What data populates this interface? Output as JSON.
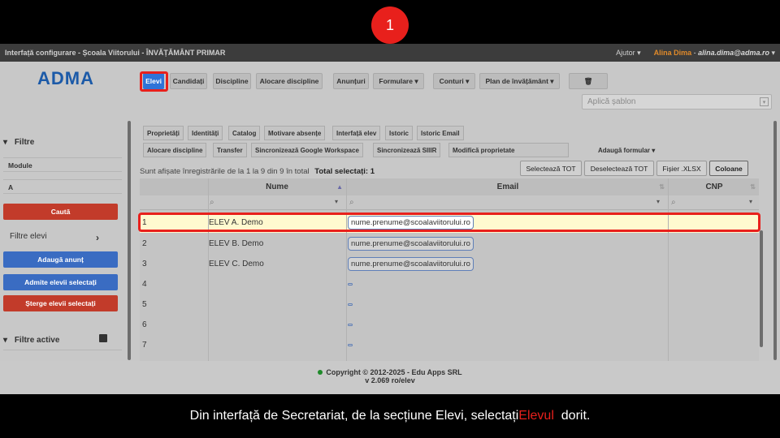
{
  "step": "1",
  "topbar": {
    "title": "Interfață configurare - Școala Viitorului - ÎNVĂȚĂMÂNT PRIMAR",
    "help": "Ajutor ▾",
    "user": "Alina Dima",
    "sep": " - ",
    "email": "alina.dima@adma.ro",
    "caret": "▾"
  },
  "logo": "ADMA",
  "toolbar": {
    "elevi": "Elevi",
    "candidati": "Candidați",
    "discipline": "Discipline",
    "alocare": "Alocare discipline",
    "anunturi": "Anunțuri",
    "formulare": "Formulare ▾",
    "conturi": "Conturi ▾",
    "plan": "Plan de învățământ ▾",
    "trash": "🗑"
  },
  "template_placeholder": "Aplică șablon",
  "sidebar": {
    "filters_title": "Filtre",
    "module_label": "Module",
    "module_value": "A",
    "search_button": "Caută",
    "students_filter": "Filtre elevi",
    "add_announcement": "Adaugă anunț",
    "admit_selected": "Admite elevii selectați",
    "delete_selected": "Șterge elevii selectați",
    "active_filters": "Filtre active"
  },
  "tabs_row1": [
    "Proprietăți",
    "Identități",
    "Catalog",
    "Motivare absențe",
    "Interfață elev",
    "Istoric",
    "Istoric Email"
  ],
  "tabs_row2": [
    "Alocare discipline",
    "Transfer",
    "Sincronizează Google Workspace",
    "Sincronizează SIIIR",
    "Modifică proprietate",
    "Adaugă formular ▾"
  ],
  "info": {
    "text": "Sunt afișate înregistrările de la 1 la 9 din 9 în total",
    "total": "Total selectați: 1"
  },
  "actions": {
    "select_all": "Selectează TOT",
    "deselect_all": "Deselectează TOT",
    "xlsx": "Fișier .XLSX",
    "columns": "Coloane"
  },
  "table": {
    "columns": [
      "Nume",
      "Email",
      "CNP"
    ],
    "rows": [
      {
        "nr": "1",
        "name": "ELEV A. Demo",
        "email": "nume.prenume@scoalaviitorului.ro"
      },
      {
        "nr": "2",
        "name": "ELEV B. Demo",
        "email": "nume.prenume@scoalaviitorului.ro"
      },
      {
        "nr": "3",
        "name": "ELEV C. Demo",
        "email": "nume.prenume@scoalaviitorului.ro"
      },
      {
        "nr": "4",
        "name": "",
        "email": ""
      },
      {
        "nr": "5",
        "name": "",
        "email": ""
      },
      {
        "nr": "6",
        "name": "",
        "email": ""
      },
      {
        "nr": "7",
        "name": "",
        "email": ""
      }
    ]
  },
  "footer": {
    "copyright": "Copyright © 2012-2025 - Edu Apps SRL",
    "version": "v 2.069 ro/elev"
  },
  "caption": {
    "before": "Din interfață de Secretariat, de la secțiune Elevi, selectați ",
    "highlight": "Elevul",
    "after": "  dorit."
  },
  "colors": {
    "accent": "#2f73d8",
    "highlight": "#e8201c",
    "selected_row": "#fff9cf"
  }
}
